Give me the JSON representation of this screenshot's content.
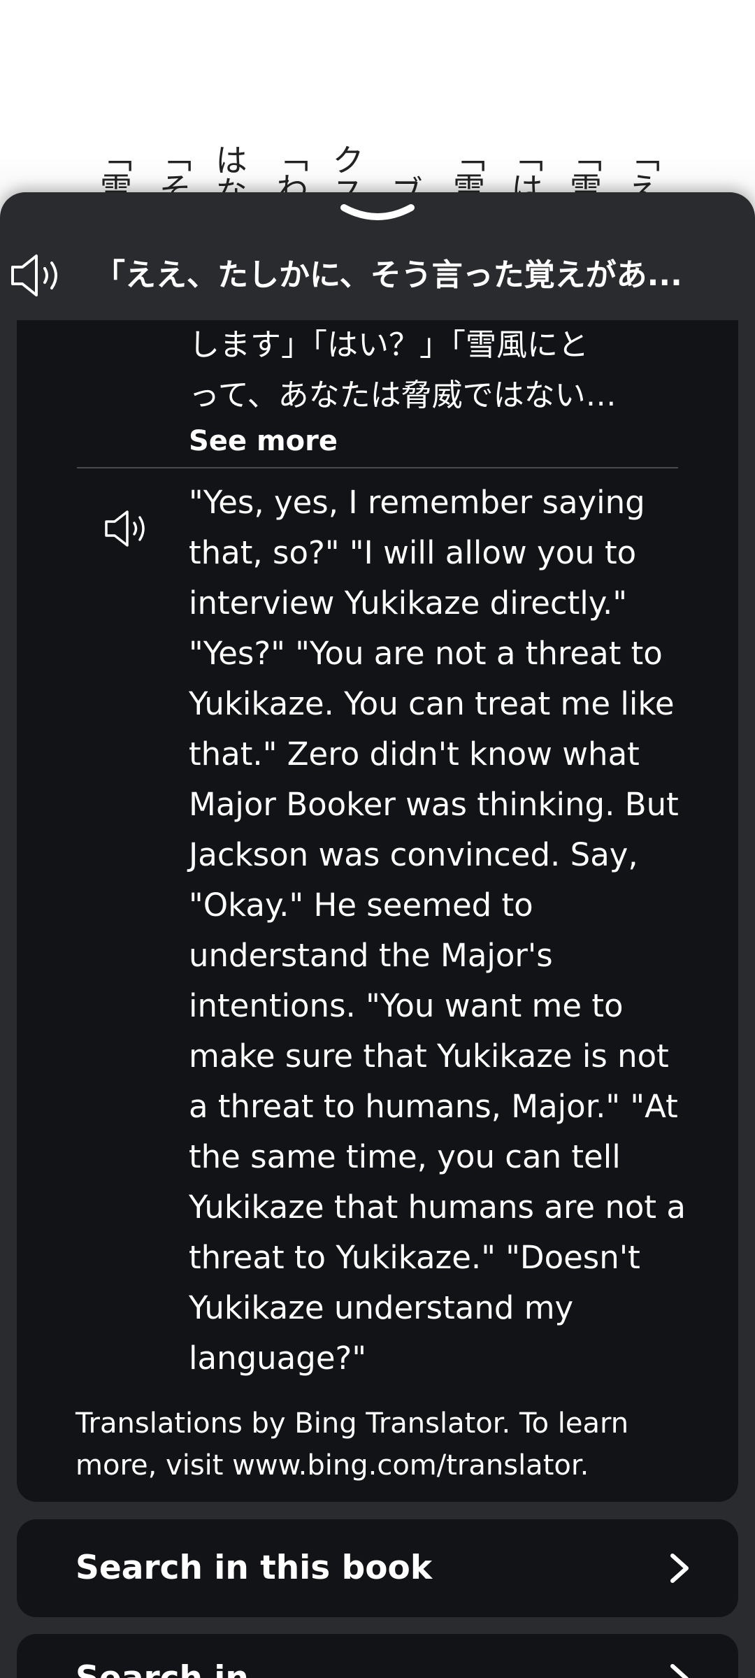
{
  "book_background": {
    "columns": [
      "「雪",
      "「そ",
      "はな",
      "「わ",
      "クス",
      "ブ",
      "「雪",
      "「は",
      "「雪",
      "「え"
    ]
  },
  "sheet": {
    "header": {
      "speaker_icon": "speaker-icon",
      "title": "「ええ、たしかに、そう言った覚えがあ..."
    },
    "translation": {
      "japanese_lines": [
        "します」「はい？」「雪風にと",
        "って、あなたは脅威ではない…"
      ],
      "see_more_label": "See more",
      "speaker_icon": "speaker-icon",
      "english_lines": [
        "\"Yes, yes, I remember saying",
        "that, so?\" \"I will allow you to",
        "interview Yukikaze directly.\"",
        "\"Yes?\" \"You are not a threat to",
        "Yukikaze. You can treat me like",
        "that.\" Zero didn't know what",
        "Major Booker was thinking. But",
        "Jackson was convinced. Say,",
        "\"Okay.\" He seemed to",
        "understand the Major's",
        "intentions. \"You want me to",
        "make sure that Yukikaze is not",
        "a threat to humans, Major.\" \"At",
        "the same time, you can tell",
        "Yukikaze that humans are not a",
        "threat to Yukikaze.\" \"Doesn't",
        "Yukikaze understand my",
        "language?\""
      ],
      "credit_lines": [
        "Translations by Bing Translator. To learn",
        "more, visit www.bing.com/translator."
      ]
    },
    "search": {
      "label": "Search in this book",
      "chevron_icon": "chevron-right-icon"
    },
    "next_row": {
      "label": "Search in",
      "chevron_icon": "chevron-right-icon"
    }
  },
  "colors": {
    "sheet_bg": "#2a2b2e",
    "card_bg": "#121316",
    "text": "#ffffff"
  }
}
